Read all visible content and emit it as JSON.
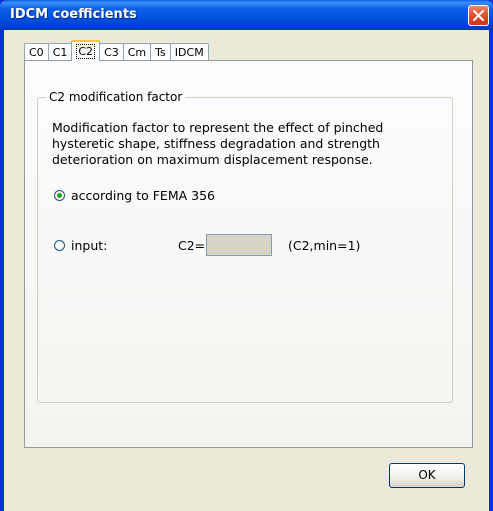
{
  "window": {
    "title": "IDCM coefficients",
    "accent": "#0a5fe6",
    "close_color": "#e0522a"
  },
  "tabs": [
    {
      "label": "C0",
      "active": false
    },
    {
      "label": "C1",
      "active": false
    },
    {
      "label": "C2",
      "active": true
    },
    {
      "label": "C3",
      "active": false
    },
    {
      "label": "Cm",
      "active": false
    },
    {
      "label": "Ts",
      "active": false
    },
    {
      "label": "IDCM",
      "active": false
    }
  ],
  "group": {
    "legend": "C2 modification factor",
    "description_lines": [
      "Modification factor to represent the effect of pinched",
      "hysteretic shape, stiffness degradation and strength",
      "deterioration on maximum displacement response."
    ],
    "option_fema": {
      "label": "according to FEMA 356",
      "checked": true
    },
    "option_input": {
      "label": "input:",
      "checked": false
    },
    "c2_label": "C2=",
    "c2_value": "",
    "c2_note": "(C2,min=1)"
  },
  "buttons": {
    "ok": "OK"
  }
}
